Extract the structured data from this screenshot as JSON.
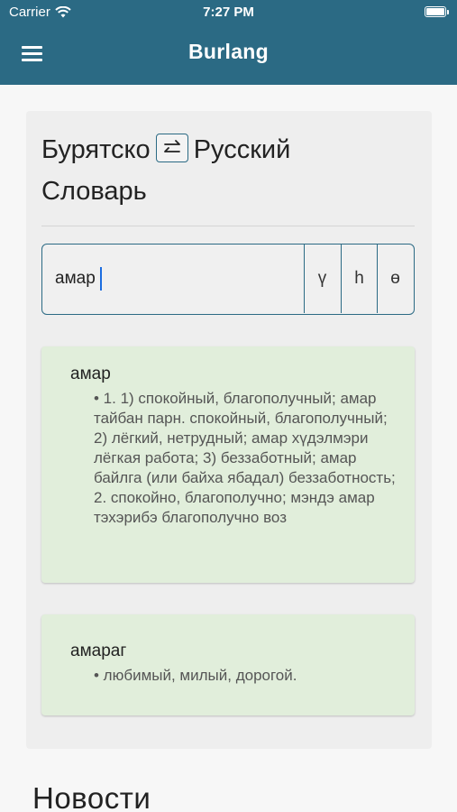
{
  "status_bar": {
    "carrier": "Carrier",
    "time": "7:27 PM"
  },
  "header": {
    "title": "Burlang",
    "menu_icon": "hamburger-icon"
  },
  "dictionary": {
    "title_from": "Бурятско",
    "title_to": "Русский",
    "title_suffix": "Словарь",
    "swap_icon": "swap-arrows-icon"
  },
  "search": {
    "value": "амар",
    "special_chars": [
      "ү",
      "һ",
      "ө"
    ]
  },
  "results": [
    {
      "word": "амар",
      "definition": "• 1. 1) спокойный, благополучный; амар тайбан парн. спокойный, благополучный; 2) лёгкий, нетрудный; амар хүдэлмэри лёгкая работа; 3) беззаботный; амар байлга (или байха ябадал) беззаботность; 2. спокойно, благополучно; мэндэ амар тэхэрибэ благополучно воз"
    },
    {
      "word": "амараг",
      "definition": "• любимый, милый, дорогой."
    }
  ],
  "news": {
    "heading": "Новости"
  },
  "colors": {
    "header": "#2b6a84",
    "result_bg": "#e1eedb",
    "card_bg": "#eeeeee"
  }
}
